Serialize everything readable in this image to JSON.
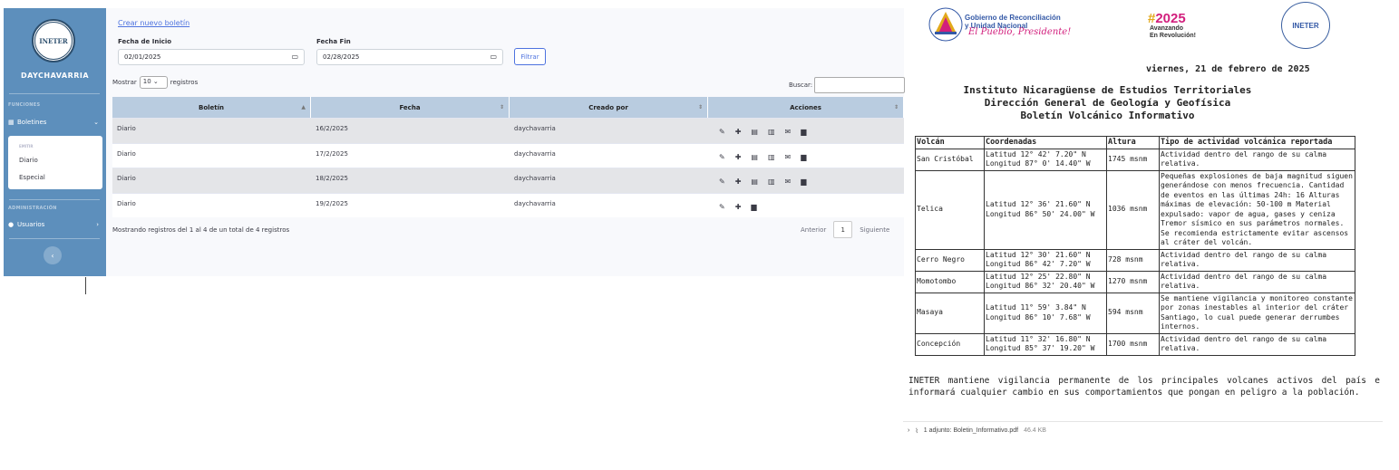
{
  "sidebar": {
    "logo_text": "INETER",
    "brand": "DAYCHAVARRIA",
    "section_functions": "FUNCIONES",
    "menu_boletines": "Boletines",
    "submenu_header": "EMITIR",
    "submenu_items": [
      "Diario",
      "Especial"
    ],
    "section_admin": "ADMINISTRACIÓN",
    "menu_usuarios": "Usuarios",
    "toggle_icon": "‹"
  },
  "main": {
    "create_link": "Crear nuevo boletín",
    "start_label": "Fecha de Inicio",
    "start_value": "02/01/2025",
    "end_label": "Fecha Fin",
    "end_value": "02/28/2025",
    "filter_button": "Filtrar",
    "show_prefix": "Mostrar",
    "show_value": "10",
    "show_suffix": "registros",
    "search_label": "Buscar:",
    "columns": [
      "Boletín",
      "Fecha",
      "Creado por",
      "Acciones"
    ],
    "rows": [
      {
        "boletin": "Diario",
        "fecha": "16/2/2025",
        "creado": "daychavarria"
      },
      {
        "boletin": "Diario",
        "fecha": "17/2/2025",
        "creado": "daychavarria"
      },
      {
        "boletin": "Diario",
        "fecha": "18/2/2025",
        "creado": "daychavarria"
      },
      {
        "boletin": "Diario",
        "fecha": "19/2/2025",
        "creado": "daychavarria"
      }
    ],
    "info": "Mostrando registros del 1 al 4 de un total de 4 registros",
    "prev": "Anterior",
    "page": "1",
    "next": "Siguiente"
  },
  "doc": {
    "gob_line1": "Gobierno de Reconciliación",
    "gob_line2": "y Unidad Nacional",
    "gob_script": "El Pueblo, Presidente!",
    "year_hash": "#",
    "year": "2025",
    "avanz1": "Avanzando",
    "avanz2": "En Revolución!",
    "ineter": "INETER",
    "date": "viernes, 21 de febrero de 2025",
    "title1": "Instituto Nicaragüense de Estudios Territoriales",
    "title2": "Dirección General de Geología y Geofísica",
    "title3": "Boletín Volcánico Informativo",
    "table_headers": [
      "Volcán",
      "Coordenadas",
      "Altura",
      "Tipo de actividad volcánica reportada"
    ],
    "volcanoes": [
      {
        "name": "San Cristóbal",
        "lat": "Latitud 12° 42' 7.20\" N",
        "lon": "Longitud 87° 0' 14.40\" W",
        "alt": "1745 msnm",
        "act": "Actividad dentro del rango de su calma relativa."
      },
      {
        "name": "Telica",
        "lat": "Latitud 12° 36' 21.60\" N",
        "lon": "Longitud 86° 50' 24.00\" W",
        "alt": "1036 msnm",
        "act": "Pequeñas explosiones de baja magnitud siguen generándose con menos frecuencia. Cantidad de eventos en las últimas 24h: 16 Alturas máximas de elevación: 50-100 m Material expulsado: vapor de agua, gases y ceniza Tremor sísmico en sus parámetros normales. Se recomienda estrictamente evitar ascensos al cráter del volcán."
      },
      {
        "name": "Cerro Negro",
        "lat": "Latitud 12° 30' 21.60\" N",
        "lon": "Longitud 86° 42' 7.20\" W",
        "alt": "728 msnm",
        "act": "Actividad dentro del rango de su calma relativa."
      },
      {
        "name": "Momotombo",
        "lat": "Latitud 12° 25' 22.80\" N",
        "lon": "Longitud 86° 32' 20.40\" W",
        "alt": "1270 msnm",
        "act": "Actividad dentro del rango de su calma relativa."
      },
      {
        "name": "Masaya",
        "lat": "Latitud 11° 59' 3.84\" N",
        "lon": "Longitud 86° 10' 7.68\" W",
        "alt": "594 msnm",
        "act": "Se mantiene vigilancia y monitoreo constante por zonas inestables al interior del cráter Santiago, lo cual puede generar derrumbes internos."
      },
      {
        "name": "Concepción",
        "lat": "Latitud 11° 32' 16.80\" N",
        "lon": "Longitud 85° 37' 19.20\" W",
        "alt": "1700 msnm",
        "act": "Actividad dentro del rango de su calma relativa."
      }
    ],
    "closing": "INETER mantiene vigilancia permanente de los principales volcanes activos del país e informará cualquier cambio en sus comportamientos que pongan en peligro a la población.",
    "attach_label": "1 adjunto: Boletin_Informativo.pdf",
    "attach_size": "46.4 KB"
  }
}
